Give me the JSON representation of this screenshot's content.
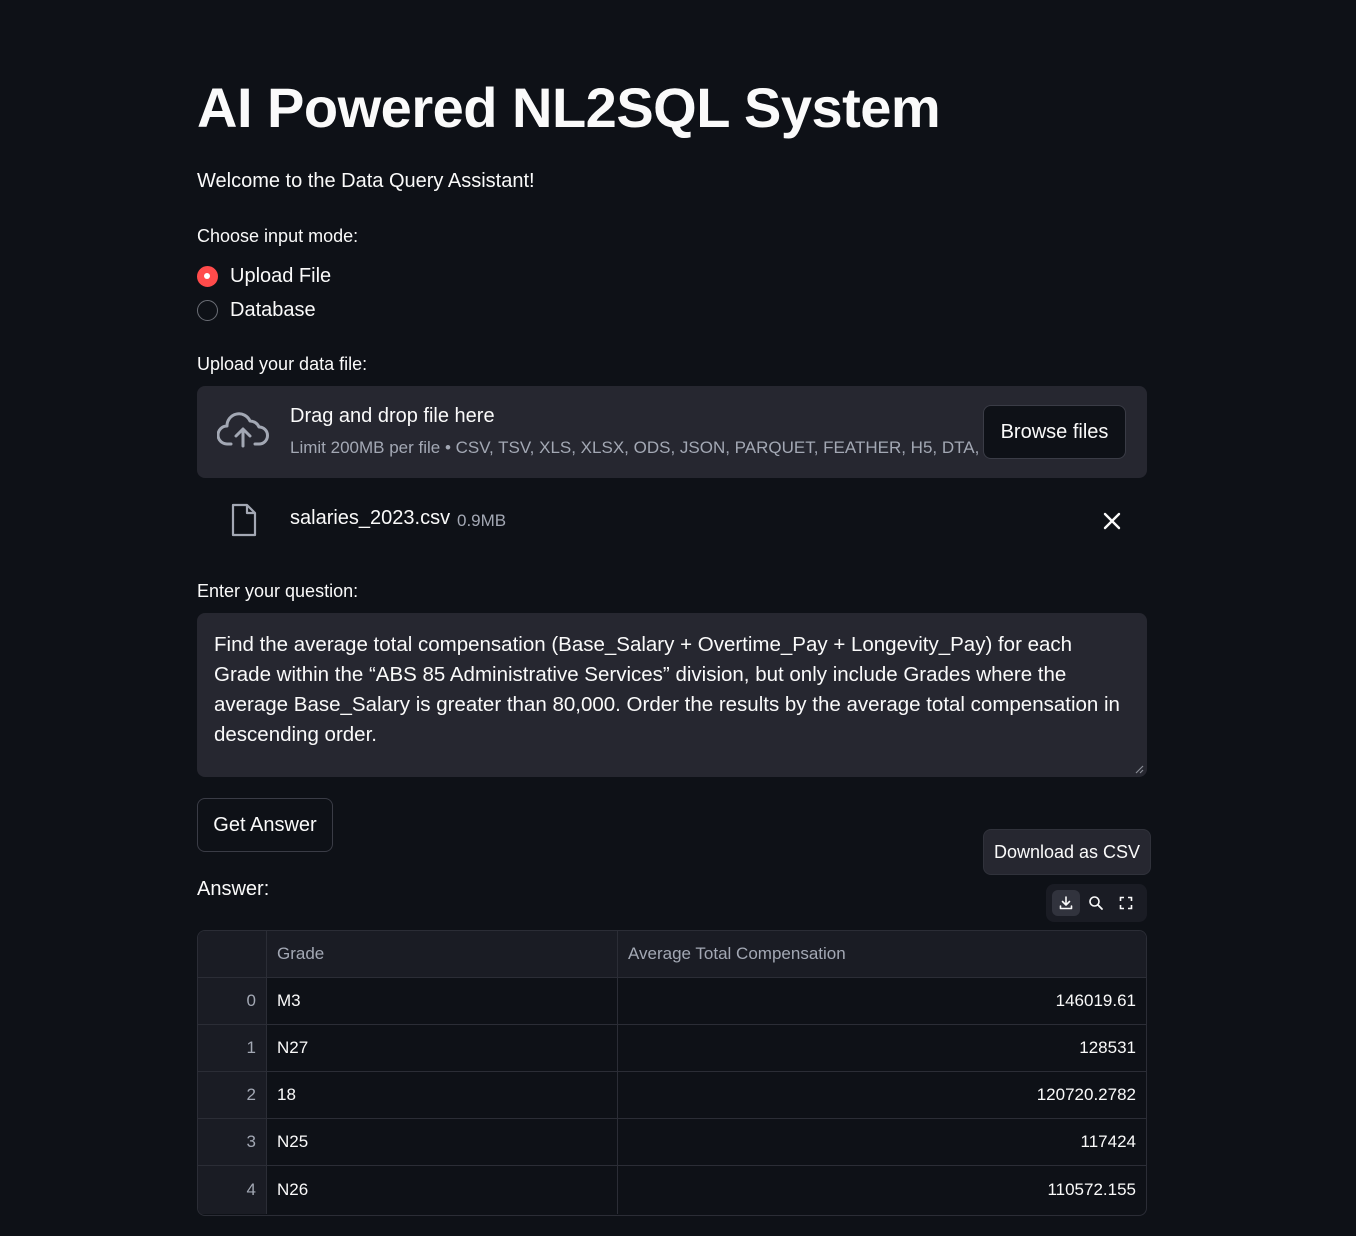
{
  "header": {
    "title": "AI Powered NL2SQL System",
    "welcome": "Welcome to the Data Query Assistant!"
  },
  "input_mode": {
    "label": "Choose input mode:",
    "options": [
      "Upload File",
      "Database"
    ],
    "selected": "Upload File"
  },
  "uploader": {
    "label": "Upload your data file:",
    "title": "Drag and drop file here",
    "subtitle": "Limit 200MB per file • CSV, TSV, XLS, XLSX, ODS, JSON, PARQUET, FEATHER, H5, DTA, …",
    "browse_label": "Browse files",
    "file_name": "salaries_2023.csv",
    "file_size": "0.9MB"
  },
  "question": {
    "label": "Enter your question:",
    "value": "Find the average total compensation (Base_Salary + Overtime_Pay + Longevity_Pay) for each Grade within the “ABS 85 Administrative Services” division, but only include Grades where the average Base_Salary is greater than 80,000. Order the results by the average total compensation in descending order."
  },
  "actions": {
    "get_answer": "Get Answer",
    "download_csv": "Download as CSV"
  },
  "answer": {
    "label": "Answer:",
    "columns": [
      "",
      "Grade",
      "Average Total Compensation"
    ],
    "rows": [
      [
        "0",
        "M3",
        "146019.61"
      ],
      [
        "1",
        "N27",
        "128531"
      ],
      [
        "2",
        "18",
        "120720.2782"
      ],
      [
        "3",
        "N25",
        "117424"
      ],
      [
        "4",
        "N26",
        "110572.155"
      ]
    ]
  },
  "colors": {
    "background": "#0e1117",
    "surface": "#262730",
    "accent": "#ff4b4b"
  }
}
